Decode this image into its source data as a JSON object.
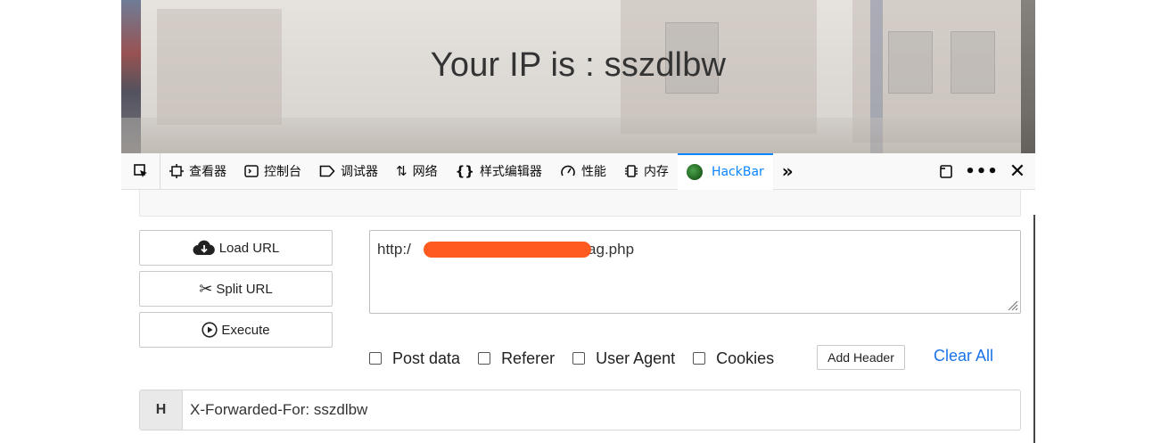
{
  "page": {
    "message": "Your IP is : sszdlbw"
  },
  "devtools": {
    "tabs": [
      {
        "label": "查看器",
        "icon": "inspector-icon"
      },
      {
        "label": "控制台",
        "icon": "console-icon"
      },
      {
        "label": "调试器",
        "icon": "debugger-icon"
      },
      {
        "label": "网络",
        "icon": "network-icon"
      },
      {
        "label": "样式编辑器",
        "icon": "style-editor-icon"
      },
      {
        "label": "性能",
        "icon": "performance-icon"
      },
      {
        "label": "内存",
        "icon": "memory-icon"
      },
      {
        "label": "HackBar",
        "icon": "hackbar-icon"
      }
    ],
    "active_tab": "HackBar",
    "accent_color": "#0a84ff"
  },
  "hackbar": {
    "buttons": {
      "load_url": "Load URL",
      "split_url": "Split URL",
      "execute": "Execute"
    },
    "url_prefix": "http:/",
    "url_suffix": "/flag.php",
    "options": {
      "post_data": "Post data",
      "referer": "Referer",
      "user_agent": "User Agent",
      "cookies": "Cookies"
    },
    "add_header": "Add Header",
    "clear_all": "Clear All",
    "header": {
      "badge": "H",
      "value": "X-Forwarded-For: sszdlbw"
    },
    "redaction_color": "#ff5a1f",
    "link_color": "#1a73e8"
  }
}
